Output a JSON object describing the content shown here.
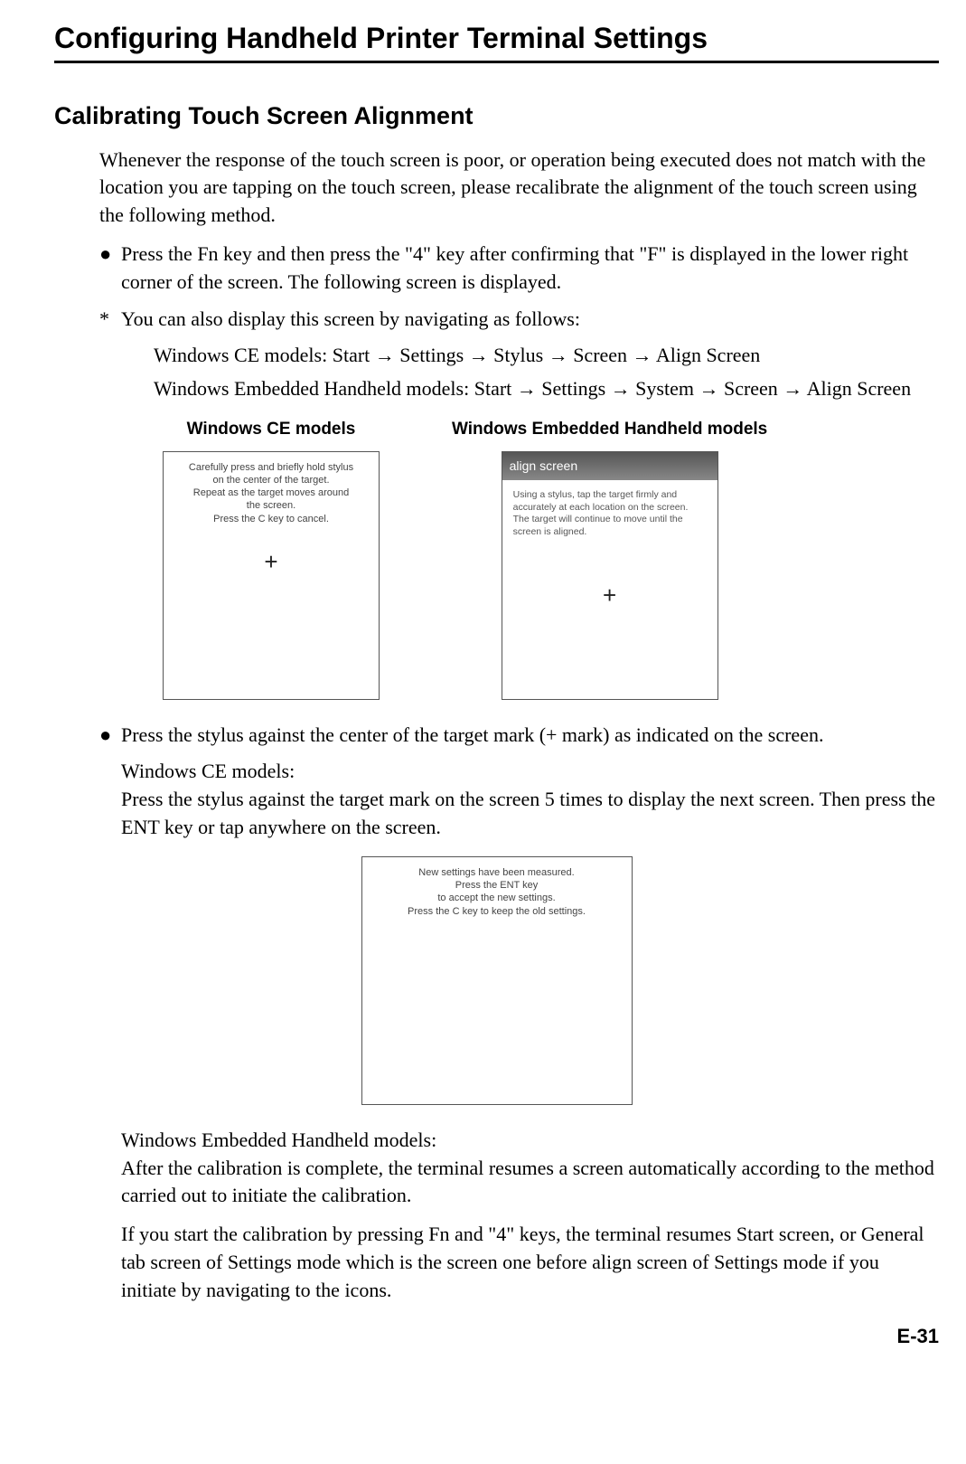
{
  "page": {
    "header": "Configuring Handheld Printer Terminal Settings",
    "subsection": "Calibrating Touch Screen Alignment",
    "intro": "Whenever the response of the touch screen is poor, or operation being executed does not match with the location you are tapping on the touch screen, please recalibrate the alignment of the touch screen using the following method.",
    "bullet1": "Press the Fn key and then press the \"4\" key after confirming that \"F\" is displayed in the lower right corner of the screen.  The following screen is displayed.",
    "asterisk_line": "You can also display this screen by navigating as follows:",
    "nav_ce": "Windows CE models: Start → Settings → Stylus → Screen → Align Screen",
    "nav_weh": "Windows Embedded Handheld models: Start → Settings → System → Screen → Align Screen",
    "caption_ce": "Windows CE models",
    "caption_weh": "Windows Embedded Handheld models",
    "ce_screen_l1": "Carefully press and briefly hold stylus",
    "ce_screen_l2": "on the center of the target.",
    "ce_screen_l3": "Repeat as the target moves around",
    "ce_screen_l4": "the screen.",
    "ce_screen_l5": "Press the C key to cancel.",
    "weh_title": "align screen",
    "weh_body": "Using a stylus, tap the target firmly and accurately at each location on the screen. The target will continue to move until the screen is aligned.",
    "bullet2": "Press the stylus against the center of the target mark (+ mark) as indicated on the screen.",
    "ce_label": "Windows CE models:",
    "ce_instr": "Press the stylus against the target mark on the screen 5 times to display the next screen. Then press the ENT key or tap anywhere on the screen.",
    "ce2_l1": "New settings have been measured.",
    "ce2_l2": "Press the ENT key",
    "ce2_l3": "to accept the new settings.",
    "ce2_l4": "Press the C key to keep the old settings.",
    "weh_label": "Windows Embedded Handheld models:",
    "weh_instr": "After the calibration is complete, the terminal resumes a screen automatically according to the method carried out to initiate the calibration.",
    "final_para": "If you start the calibration by pressing Fn and \"4\" keys, the terminal resumes Start screen, or General tab screen of Settings mode which is the screen one before align screen of Settings mode if you initiate by navigating to the icons.",
    "page_number": "E-31",
    "plus": "+",
    "bullet_symbol": "●",
    "asterisk_symbol": "*"
  }
}
